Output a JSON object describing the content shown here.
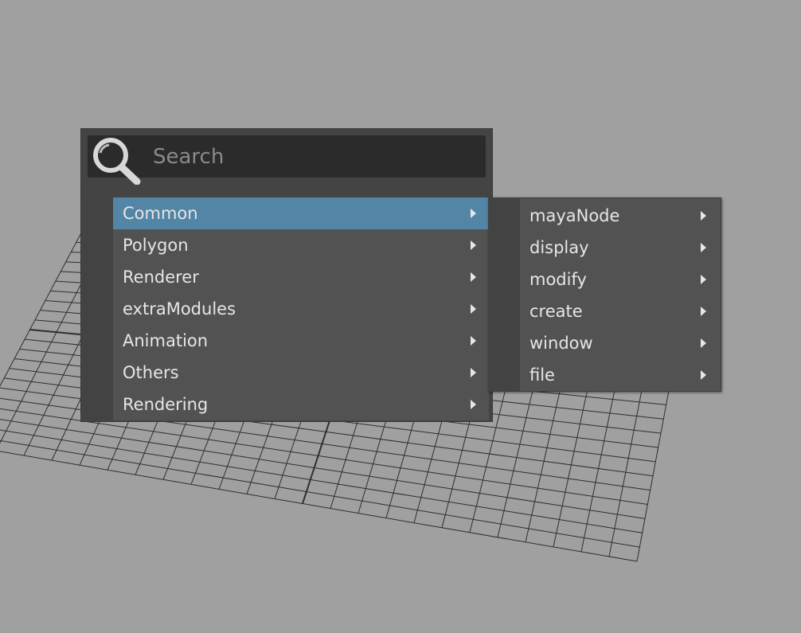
{
  "search": {
    "placeholder": "Search",
    "icon": "magnifier-icon"
  },
  "main_menu": {
    "items": [
      {
        "label": "Common",
        "active": true
      },
      {
        "label": "Polygon"
      },
      {
        "label": "Renderer"
      },
      {
        "label": "extraModules"
      },
      {
        "label": "Animation"
      },
      {
        "label": "Others"
      },
      {
        "label": "Rendering"
      }
    ]
  },
  "sub_menu": {
    "items": [
      {
        "label": "mayaNode"
      },
      {
        "label": "display"
      },
      {
        "label": "modify"
      },
      {
        "label": "create"
      },
      {
        "label": "window"
      },
      {
        "label": "file"
      }
    ]
  },
  "colors": {
    "viewport_bg": "#a0a0a0",
    "menu_bg": "#525252",
    "menu_gutter": "#434343",
    "highlight": "#5285a6",
    "text": "#e6e6e6",
    "grid_line": "#2e2e2e"
  }
}
